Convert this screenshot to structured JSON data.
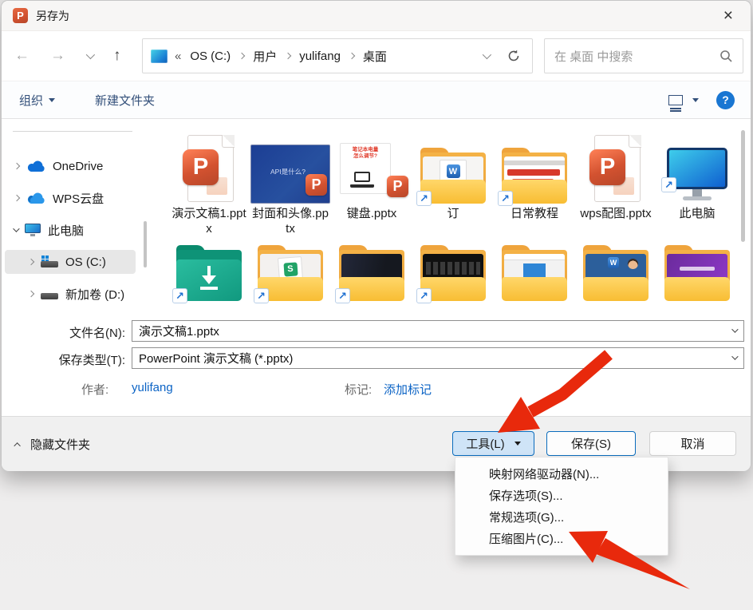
{
  "window": {
    "title": "另存为",
    "close_glyph": "×"
  },
  "nav": {
    "back_glyph": "←",
    "forward_glyph": "→",
    "up_glyph": "↑",
    "breadcrumb": {
      "overflow": "«",
      "items": [
        "OS (C:)",
        "用户",
        "yulifang",
        "桌面"
      ]
    },
    "search_placeholder": "在 桌面 中搜索"
  },
  "toolbar": {
    "organize": "组织",
    "new_folder": "新建文件夹",
    "help_glyph": "?"
  },
  "sidebar": {
    "items": [
      {
        "label": "OneDrive"
      },
      {
        "label": "WPS云盘"
      },
      {
        "label": "此电脑"
      },
      {
        "label": "OS (C:)"
      },
      {
        "label": "新加卷 (D:)"
      }
    ]
  },
  "files": {
    "row1": [
      {
        "label": "演示文稿1.pptx"
      },
      {
        "label": "封面和头像.pptx",
        "thumb_text": "API是什么?"
      },
      {
        "label": "键盘.pptx",
        "thumb_line1": "笔记本电量",
        "thumb_line2": "怎么调节?"
      },
      {
        "label": "订"
      },
      {
        "label": "日常教程"
      },
      {
        "label": "wps配图.pptx"
      },
      {
        "label": "此电脑"
      }
    ]
  },
  "form": {
    "filename_label": "文件名(N):",
    "filename_value": "演示文稿1.pptx",
    "type_label": "保存类型(T):",
    "type_value": "PowerPoint 演示文稿 (*.pptx)",
    "author_label": "作者:",
    "author_value": "yulifang",
    "tags_label": "标记:",
    "tags_value": "添加标记"
  },
  "footer": {
    "hide_folders": "隐藏文件夹",
    "tools": "工具(L)",
    "save": "保存(S)",
    "cancel": "取消"
  },
  "menu": {
    "items": [
      "映射网络驱动器(N)...",
      "保存选项(S)...",
      "常规选项(G)...",
      "压缩图片(C)..."
    ]
  },
  "badges": {
    "ppt": "P",
    "word": "W",
    "sheet": "S"
  },
  "colors": {
    "accent": "#0078d4",
    "arrow_red": "#e8290c",
    "ppt_orange": "#d35230",
    "folder_yellow": "#f8bd33"
  }
}
